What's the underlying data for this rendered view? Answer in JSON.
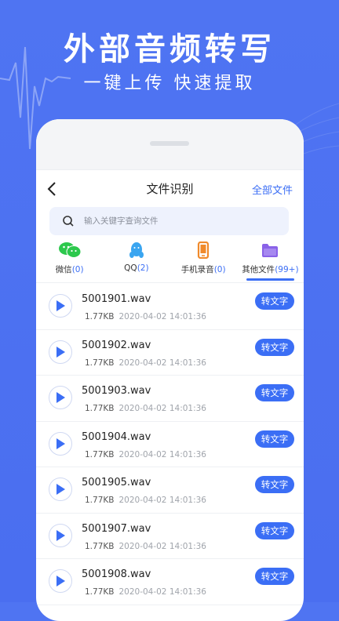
{
  "promo": {
    "title": "外部音频转写",
    "subtitle": "一键上传  快速提取"
  },
  "nav": {
    "title": "文件识别",
    "all_files": "全部文件"
  },
  "search": {
    "placeholder": "输入关键字查询文件"
  },
  "tabs": [
    {
      "label": "微信",
      "count": "(0)",
      "icon": "wechat-icon",
      "color": "#2dc84d"
    },
    {
      "label": "QQ",
      "count": "(2)",
      "icon": "qq-icon",
      "color": "#3aa5f0"
    },
    {
      "label": "手机录音",
      "count": "(0)",
      "icon": "phone-icon",
      "color": "#f08a2b"
    },
    {
      "label": "其他文件",
      "count": "(99+)",
      "icon": "folder-icon",
      "color": "#8a62e8",
      "active": true
    }
  ],
  "files": [
    {
      "name": "5001901.wav",
      "size": "1.77KB",
      "time": "2020-04-02 14:01:36",
      "action": "转文字"
    },
    {
      "name": "5001902.wav",
      "size": "1.77KB",
      "time": "2020-04-02 14:01:36",
      "action": "转文字"
    },
    {
      "name": "5001903.wav",
      "size": "1.77KB",
      "time": "2020-04-02 14:01:36",
      "action": "转文字"
    },
    {
      "name": "5001904.wav",
      "size": "1.77KB",
      "time": "2020-04-02 14:01:36",
      "action": "转文字"
    },
    {
      "name": "5001905.wav",
      "size": "1.77KB",
      "time": "2020-04-02 14:01:36",
      "action": "转文字"
    },
    {
      "name": "5001907.wav",
      "size": "1.77KB",
      "time": "2020-04-02 14:01:36",
      "action": "转文字"
    },
    {
      "name": "5001908.wav",
      "size": "1.77KB",
      "time": "2020-04-02 14:01:36",
      "action": "转文字"
    }
  ],
  "colors": {
    "background": "#4a6ef0",
    "accent": "#3b6ef5"
  }
}
